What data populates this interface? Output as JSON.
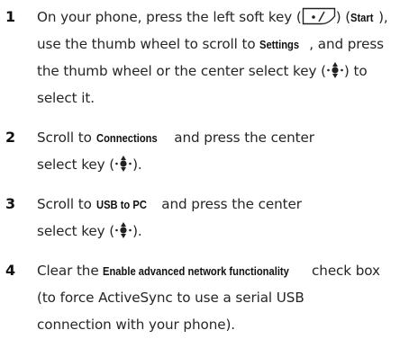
{
  "steps": [
    {
      "number": "1",
      "lines": {
        "l1a": "On your phone, press the left soft key (",
        "l1b": ") (",
        "l1c": "Start",
        "l1d": "),",
        "l2a": "use the thumb wheel to scroll to ",
        "l2b": "Settings",
        "l2c": ", and press",
        "l3a": "the thumb wheel or the center select key (",
        "l3b": ") to",
        "l4a": "select it."
      }
    },
    {
      "number": "2",
      "lines": {
        "l1a": "Scroll to ",
        "l1b": "Connections",
        "l1c": " and press the center",
        "l2a": "select key (",
        "l2b": ")."
      }
    },
    {
      "number": "3",
      "lines": {
        "l1a": "Scroll to ",
        "l1b": "USB to PC",
        "l1c": " and press the center",
        "l2a": "select key (",
        "l2b": ")."
      }
    },
    {
      "number": "4",
      "lines": {
        "l1a": "Clear the ",
        "l1b": "Enable advanced network functionality",
        "l1c": " check box",
        "l2a": "(to force ActiveSync to use a serial USB",
        "l3a": "connection with your phone)."
      }
    }
  ],
  "icons": {
    "soft_key": "left-soft-key-icon",
    "select_key": "center-select-key-icon"
  }
}
